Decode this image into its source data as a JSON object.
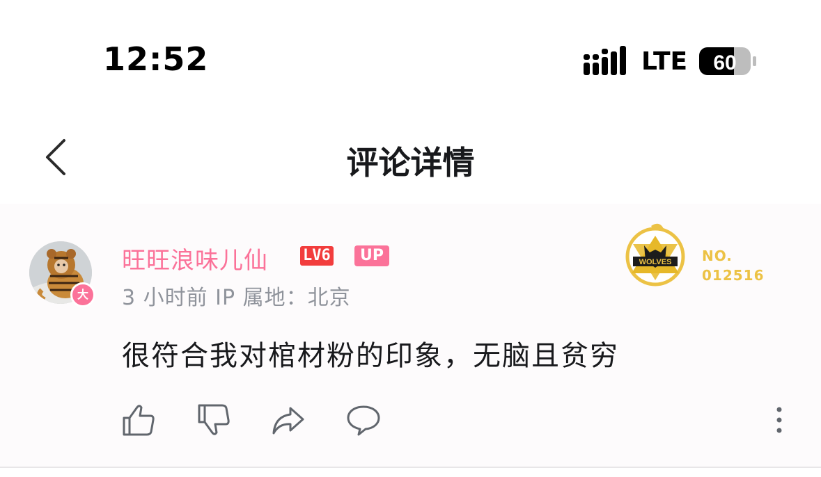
{
  "status_bar": {
    "time": "12:52",
    "network": "LTE",
    "battery": "60"
  },
  "header": {
    "title": "评论详情",
    "back_icon": "chevron-left-icon"
  },
  "comment": {
    "username": "旺旺浪味儿仙",
    "level_badge": "LV6",
    "up_badge": "UP",
    "avatar_badge": "大",
    "meta": "3 小时前  IP 属地：北京",
    "content": "很符合我对棺材粉的印象，无脑且贫穷",
    "fan_badge": {
      "emblem_text": "WOLVES",
      "label_line1": "NO.",
      "label_line2": "012516"
    },
    "actions": [
      "like-icon",
      "dislike-icon",
      "share-icon",
      "reply-icon",
      "more-icon"
    ]
  },
  "colors": {
    "accent_pink": "#fb7299",
    "level_red": "#f23d3d",
    "gold": "#ecc245",
    "meta_gray": "#8f939b"
  }
}
